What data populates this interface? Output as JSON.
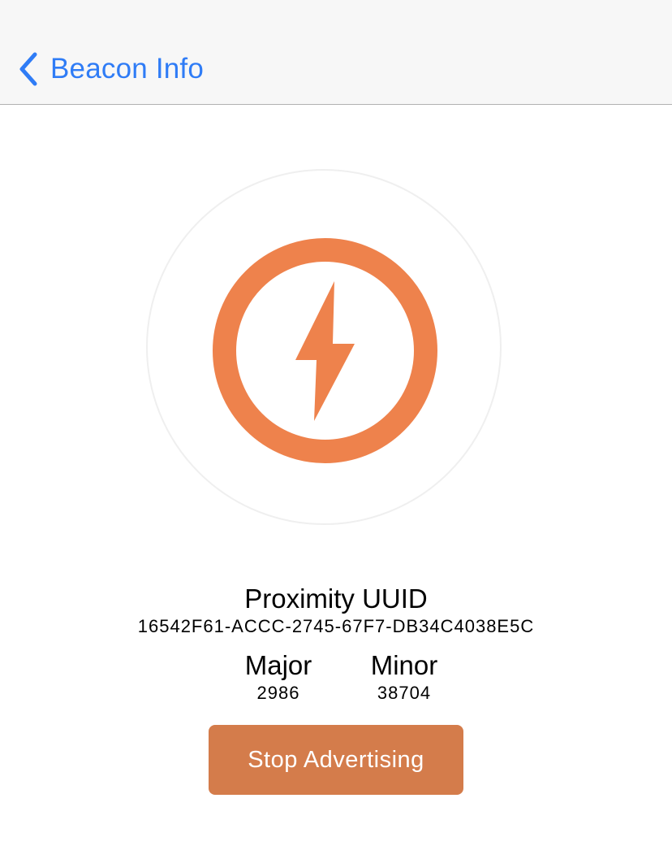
{
  "navbar": {
    "back_label": "Beacon Info",
    "back_icon": "chevron-left-icon",
    "tint_color": "#2f7cf6"
  },
  "beacon": {
    "icon": "bolt-in-circle-icon",
    "accent_color": "#ee824c",
    "uuid_title": "Proximity UUID",
    "uuid_value": "16542F61-ACCC-2745-67F7-DB34C4038E5C",
    "major_label": "Major",
    "major_value": "2986",
    "minor_label": "Minor",
    "minor_value": "38704"
  },
  "actions": {
    "stop_label": "Stop Advertising",
    "button_color": "#d47c4b"
  }
}
